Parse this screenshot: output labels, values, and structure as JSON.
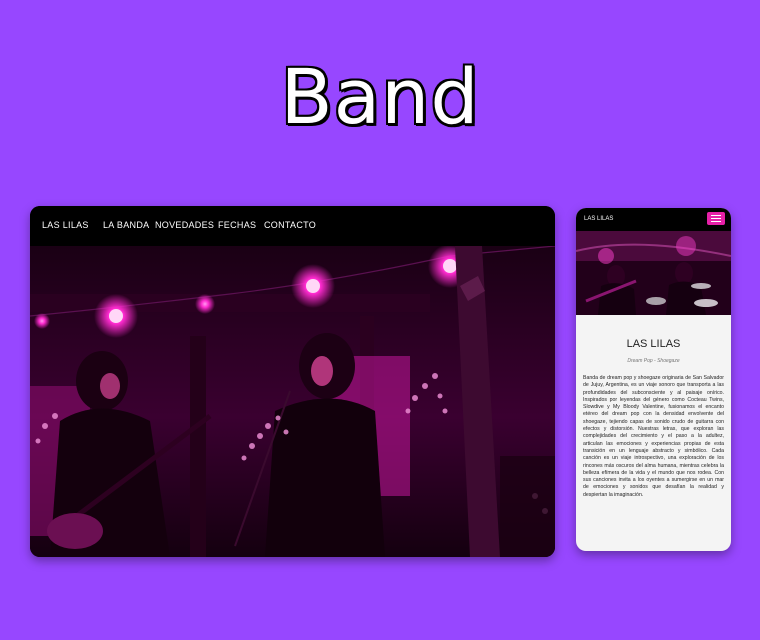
{
  "headline": "Band",
  "desktop": {
    "brand": "LAS LILAS",
    "nav": [
      "LA BANDA",
      "NOVEDADES",
      "FECHAS",
      "CONTACTO"
    ],
    "hero_alt": "band-live-photo"
  },
  "mobile": {
    "brand": "LAS LILAS",
    "menu_icon": "hamburger-icon",
    "title": "LAS LILAS",
    "subtitle": "Dream Pop - Shoegaze",
    "body": "Banda de dream pop y shoegaze originaria de San Salvador de Jujuy, Argentina, es un viaje sonoro que transporta a las profundidades del subconsciente y al paisaje onírico. Inspirados por leyendas del género como Cocteau Twins, Slowdive y My Bloody Valentine, fusionamos el encanto etéreo del dream pop con la densidad envolvente del shoegaze, tejiendo capas de sonido crudo de guitarra con efectos y distorsión. Nuestras letras, que exploran las complejidades del crecimiento y el paso a la adultez, articulan las emociones y experiencias propias de esta transición en un lenguaje abstracto y simbólico. Cada canción es un viaje introspectivo, una exploración de los rincones más oscuros del alma humana, mientras celebra la belleza efímera de la vida y el mundo que nos rodea. Con sus canciones invita a los oyentes a sumergirse en un mar de emociones y sonidos que desafían la realidad y despiertan la imaginación."
  },
  "colors": {
    "background": "#9747ff",
    "accent": "#e620a8",
    "nav_bg": "#000000"
  }
}
